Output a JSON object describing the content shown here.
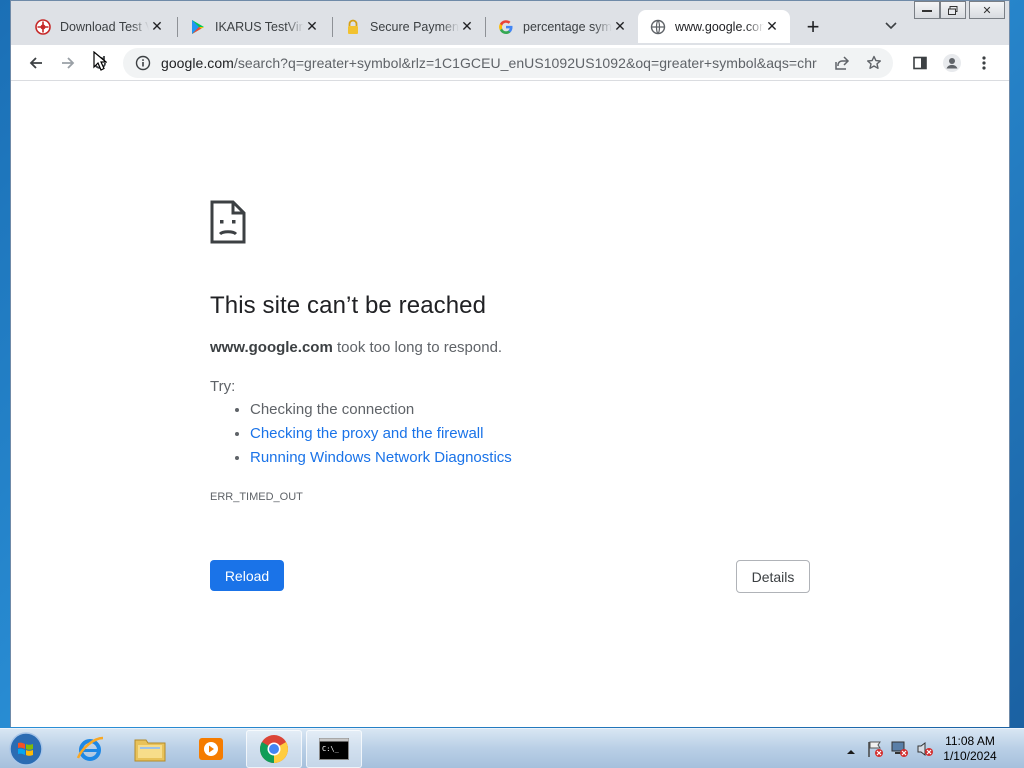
{
  "browser": {
    "tabs": [
      {
        "title": "Download Test Viruses",
        "favicon": "eicar-icon",
        "active": false
      },
      {
        "title": "IKARUS TestVirus",
        "favicon": "play-store-icon",
        "active": false
      },
      {
        "title": "Secure Payment",
        "favicon": "lock-icon",
        "active": false
      },
      {
        "title": "percentage symbol",
        "favicon": "google-icon",
        "active": false
      },
      {
        "title": "www.google.com",
        "favicon": "globe-icon",
        "active": true
      }
    ],
    "address": {
      "host": "google.com",
      "path": "/search?q=greater+symbol&rlz=1C1GCEU_enUS1092US1092&oq=greater+symbol&aqs=chro..."
    }
  },
  "error_page": {
    "title": "This site can’t be reached",
    "host": "www.google.com",
    "desc_suffix": " took too long to respond.",
    "try_label": "Try:",
    "suggestions": [
      "Checking the connection",
      "Checking the proxy and the firewall",
      "Running Windows Network Diagnostics"
    ],
    "error_code": "ERR_TIMED_OUT",
    "reload_label": "Reload",
    "details_label": "Details"
  },
  "taskbar": {
    "apps": [
      "internet-explorer-icon",
      "file-explorer-icon",
      "media-player-icon",
      "chrome-icon",
      "command-prompt-icon"
    ],
    "clock_time": "11:08 AM",
    "clock_date": "1/10/2024"
  },
  "colors": {
    "link": "#1a73e8",
    "button": "#1a73e8"
  }
}
